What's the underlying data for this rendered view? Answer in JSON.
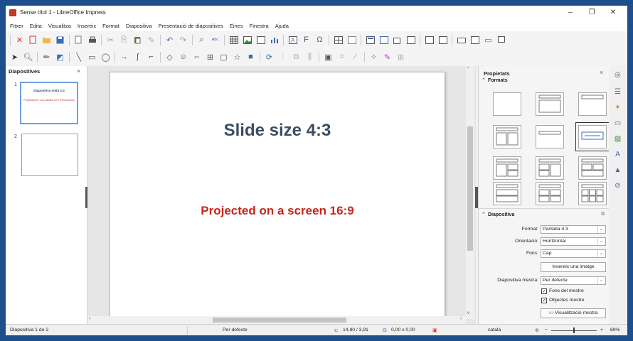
{
  "window": {
    "title": "Sense títol 1 - LibreOffice Impress",
    "minimize": "–",
    "restore": "❐",
    "close": "✕"
  },
  "menu": [
    "Fitxer",
    "Edita",
    "Visualitza",
    "Insereix",
    "Format",
    "Diapositiva",
    "Presentació de diapositives",
    "Eines",
    "Finestra",
    "Ajuda"
  ],
  "toolbar_icons": {
    "cut": "✂",
    "copy": "⎘",
    "undo": "↶",
    "redo": "↷",
    "find": "⌕",
    "spell": "ᴬᵇᶜ"
  },
  "slide_panel": {
    "title": "Diapositives",
    "close": "×",
    "thumb1_number": "1",
    "thumb1_title": "Diapositiva mida 4:3",
    "thumb1_subtitle": "Projectada en una pantalla 16:9 (Panoràmica)",
    "thumb2_number": "2"
  },
  "slide": {
    "title": "Slide size 4:3",
    "subtitle": "Projected on a screen 16:9"
  },
  "properties": {
    "title": "Propietats",
    "close": "×",
    "formats_title": "Formats",
    "diapositiva_title": "Diapositiva",
    "format_label": "Format:",
    "format_value": "Pantalla 4:3",
    "orientation_label": "Orientació:",
    "orientation_value": "Horitzontal",
    "background_label": "Fons:",
    "background_value": "Cap",
    "insert_image_button": "Insereix una imatge",
    "master_label": "Diapositiva mestra:",
    "master_value": "Per defecte",
    "master_bg_check": "Fons del mestre",
    "master_objects_check": "Objectes mestre",
    "master_view_button": "Visualització mestra"
  },
  "status": {
    "slide_counter": "Diapositiva 1 de 2",
    "master_name": "Per defecte",
    "position": "14,80 / 3,91",
    "size": "0,00 x 0,00",
    "language": "català",
    "zoom": "69%"
  }
}
